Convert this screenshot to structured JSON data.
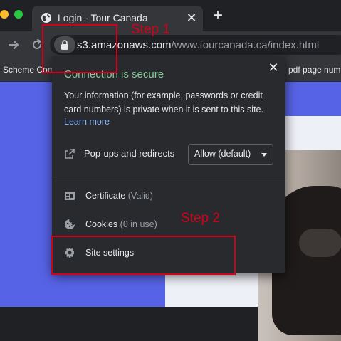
{
  "tab": {
    "title": "Login - Tour Canada",
    "close_symbol": "✕",
    "new_tab_symbol": "+"
  },
  "omnibox": {
    "host": "s3.amazonaws.com",
    "path": "/www.tourcanada.ca/index.html"
  },
  "bookmarks": {
    "left_label": "Scheme Com",
    "right_label": "pdf page num"
  },
  "popup": {
    "close_symbol": "✕",
    "title": "Connection is secure",
    "description": "Your information (for example, passwords or credit card numbers) is private when it is sent to this site.",
    "learn_more": "Learn more",
    "popups_label": "Pop-ups and redirects",
    "popups_value": "Allow (default)",
    "certificate_label": "Certificate",
    "certificate_status": "(Valid)",
    "cookies_label": "Cookies",
    "cookies_status": "(0 in use)",
    "site_settings_label": "Site settings"
  },
  "annotations": {
    "step1": "Step 1",
    "step2": "Step 2"
  },
  "colors": {
    "secure_green": "#81c995",
    "link_blue": "#8ab4f8",
    "annotation_red": "#d0021b",
    "page_background": "#5763e6"
  },
  "icons": {
    "tab": "globe-icon",
    "lock": "lock-icon",
    "popups": "external-link-icon",
    "certificate": "certificate-icon",
    "cookies": "cookie-icon",
    "settings": "gear-icon"
  }
}
